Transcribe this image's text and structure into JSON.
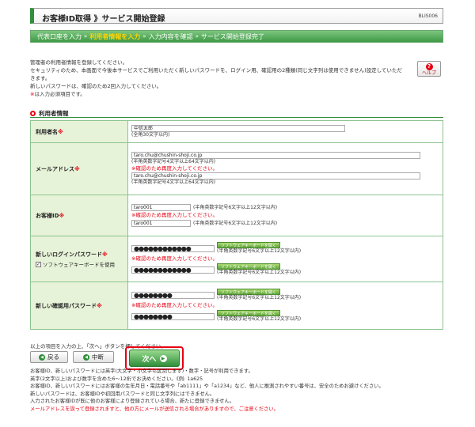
{
  "header": {
    "title": "お客様ID取得 》サービス開始登録",
    "code": "BLIS006"
  },
  "steps": [
    {
      "label": "代表口座を入力",
      "current": false
    },
    {
      "label": "利用者情報を入力",
      "current": true
    },
    {
      "label": "入力内容を確認",
      "current": false
    },
    {
      "label": "サービス開始登録完了",
      "current": false
    }
  ],
  "intro": {
    "l1": "管理者の利用者情報を登録してください。",
    "l2": "セキュリティのため、本画面で今後本サービスでご利用いただく新しいパスワードを、ログイン用、確認用の2種類(同じ文字列は使用できません)設定していただきます。",
    "l3": "新しいパスワードは、確認のため2回入力してください。",
    "l4_mark": "※",
    "l4": "は入力必須項目です。"
  },
  "help": {
    "label": "ヘルプ"
  },
  "section_title": "利用者情報",
  "form": {
    "name": {
      "label": "利用者名",
      "value": "中信太郎",
      "hint": "(全角30文字以内)"
    },
    "email": {
      "label": "メールアドレス",
      "value1": "taro.chu@chushin-shoji.co.jp",
      "hint1": "(半角英数字記号4文字以上64文字以内)",
      "confirm_note": "※確認のため再度入力してください。",
      "value2": "taro.chu@chushin-shoji.co.jp",
      "hint2": "(半角英数字記号4文字以上64文字以内)"
    },
    "userid": {
      "label": "お客様ID",
      "value1": "taro001",
      "hint1": "(半角英数字記号6文字以上12文字以内)",
      "confirm_note": "※確認のため再度入力してください。",
      "value2": "taro001",
      "hint2": "(半角英数字記号6文字以上12文字以内)"
    },
    "login_pw": {
      "label": "新しいログインパスワード",
      "softkb_check": "ソフトウェアキーボードを使用",
      "value1": "●●●●●●●●●●●●",
      "softkb_button": "ソフトウェアキーボードを開く",
      "hint": "(半角英数字記号6文字以上12文字以内)",
      "confirm_note": "※確認のため再度入力してください。",
      "value2": "●●●●●●●●●●●●"
    },
    "confirm_pw": {
      "label": "新しい確認用パスワード",
      "value1": "●●●●●●●●",
      "softkb_button": "ソフトウェアキーボードを開く",
      "hint": "(半角英数字記号6文字以上12文字以内)",
      "confirm_note": "※確認のため再度入力してください。",
      "value2": "●●●●●●●●"
    },
    "required_mark": "※"
  },
  "bottom": {
    "note": "以上の項目を入力の上、「次へ」ボタンを押してください。",
    "back": "戻る",
    "cancel": "中断",
    "next": "次へ"
  },
  "notes": {
    "n1": "お客様ID、新しいパスワードには英字(大文字・小文字も区別します)・数字・記号が利用できます。",
    "n2": "英字(2文字以上)および数字を含めた6〜12桁でお決めください。《例: 1a625",
    "n3": "お客様ID、新しいパスワードにはお客様の生年月日・電話番号や「ab1111」や「a1234」など、他人に推測されやすい番号は、安全のためお避けください。",
    "n4": "新しいパスワードは、お客様IDや初回用パスワードと同じ文字列にはできません。",
    "n5": "入力されたお客様IDが既に他のお客様により登録されている場合、新たに登録できません。",
    "n6": "メールアドレスを誤って登録されますと、他の方にメールが送信される場合がありますので、ご注意ください。"
  },
  "colors": {
    "brand_green": "#2f8f3a",
    "required_red": "#e60012",
    "label_bg": "#e7f3d8"
  }
}
